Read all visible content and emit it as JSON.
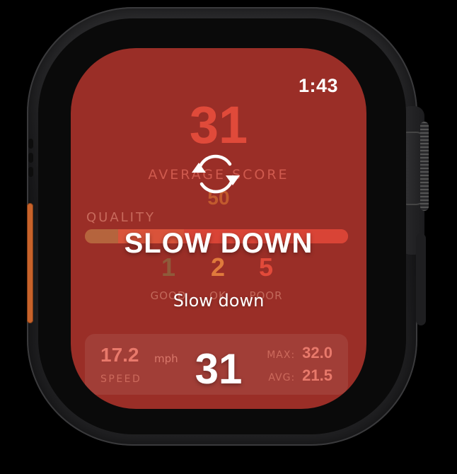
{
  "status": {
    "time": "1:43"
  },
  "score": {
    "current": "31",
    "average_label": "AVERAGE SCORE",
    "average_value": "50"
  },
  "quality": {
    "label": "QUALITY",
    "segments": [
      {
        "name": "good",
        "count": 1,
        "color": "#b5643d"
      },
      {
        "name": "ok",
        "count": 2,
        "color": "#d9533a"
      },
      {
        "name": "poor",
        "count": 5,
        "color": "#d94436"
      }
    ],
    "counts": [
      {
        "value": "1",
        "label": "GOOD",
        "color": "#8f5a3a"
      },
      {
        "value": "2",
        "label": "OK",
        "color": "#e07a3c"
      },
      {
        "value": "5",
        "label": "POOR",
        "color": "#e24a3a"
      }
    ]
  },
  "stats": {
    "speed_value": "17.2",
    "speed_unit": "mph",
    "speed_label": "SPEED",
    "max_label": "MAX:",
    "max_value": "32.0",
    "avg_label": "AVG:",
    "avg_value": "21.5"
  },
  "overlay": {
    "title": "SLOW DOWN",
    "subtitle": "Slow down",
    "score": "31",
    "icon": "sync-icon"
  },
  "colors": {
    "screen_background": "#9a2e27",
    "accent_red": "#e04a3a",
    "action_button": "#c8622a"
  }
}
